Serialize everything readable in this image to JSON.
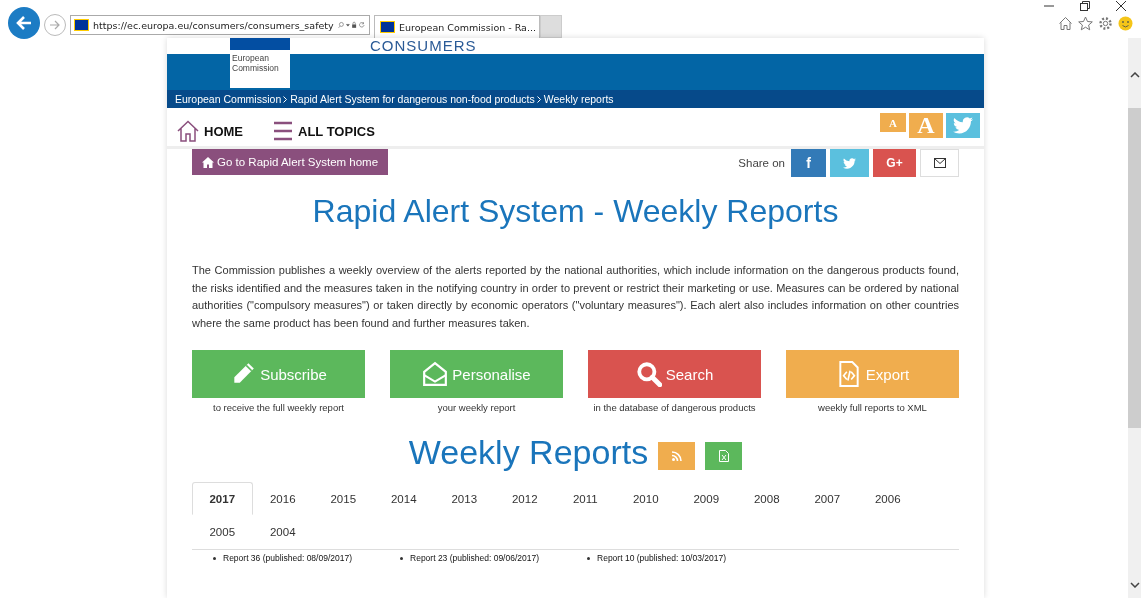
{
  "browser": {
    "url": "https://ec.europa.eu/consumers/consumers_safety",
    "tab_title": "European Commission - Ra..."
  },
  "header": {
    "logo_text": "European Commission",
    "site_title": "CONSUMERS",
    "breadcrumb": [
      "European Commission",
      "Rapid Alert System for dangerous non-food products",
      "Weekly reports"
    ]
  },
  "nav": {
    "items": [
      {
        "label": "HOME",
        "kind": "home"
      },
      {
        "label": "ALL TOPICS",
        "kind": "menu"
      }
    ],
    "font_buttons": [
      {
        "label": "A",
        "kind": "small"
      },
      {
        "label": "A",
        "kind": "large"
      }
    ]
  },
  "home_link": "Go to Rapid Alert System home",
  "share": {
    "label": "Share on",
    "buttons": [
      {
        "kind": "facebook",
        "text": "f"
      },
      {
        "kind": "twitter"
      },
      {
        "kind": "google",
        "text": "G+"
      },
      {
        "kind": "email"
      }
    ]
  },
  "title": "Rapid Alert System - Weekly Reports",
  "intro": "The Commission publishes a weekly overview of the alerts reported by the national authorities, which include information on the dangerous products found, the risks identified and the measures taken in the notifying country in order to prevent or restrict their marketing or use. Measures can be ordered by national authorities (\"compulsory measures\") or taken directly by economic operators (\"voluntary measures\"). Each alert also includes information on other countries where the same product has been found and further measures taken.",
  "actions": [
    {
      "kind": "subscribe",
      "label": "Subscribe",
      "caption": "to receive the full weekly report"
    },
    {
      "kind": "personalise",
      "label": "Personalise",
      "caption": "your weekly report"
    },
    {
      "kind": "search",
      "label": "Search",
      "caption": "in the database of dangerous products"
    },
    {
      "kind": "export",
      "label": "Export",
      "caption": "weekly full reports to XML"
    }
  ],
  "weekly_title": "Weekly Reports",
  "tabs": [
    {
      "label": "2017",
      "selected": true
    },
    {
      "label": "2016",
      "selected": false
    },
    {
      "label": "2015",
      "selected": false
    },
    {
      "label": "2014",
      "selected": false
    },
    {
      "label": "2013",
      "selected": false
    },
    {
      "label": "2012",
      "selected": false
    },
    {
      "label": "2011",
      "selected": false
    },
    {
      "label": "2010",
      "selected": false
    },
    {
      "label": "2009",
      "selected": false
    },
    {
      "label": "2008",
      "selected": false
    },
    {
      "label": "2007",
      "selected": false
    },
    {
      "label": "2006",
      "selected": false
    },
    {
      "label": "2005",
      "selected": false
    },
    {
      "label": "2004",
      "selected": false
    }
  ],
  "reports": [
    "Report 36 (published: 08/09/2017)",
    "Report 23 (published: 09/06/2017)",
    "Report 10 (published: 10/03/2017)"
  ]
}
